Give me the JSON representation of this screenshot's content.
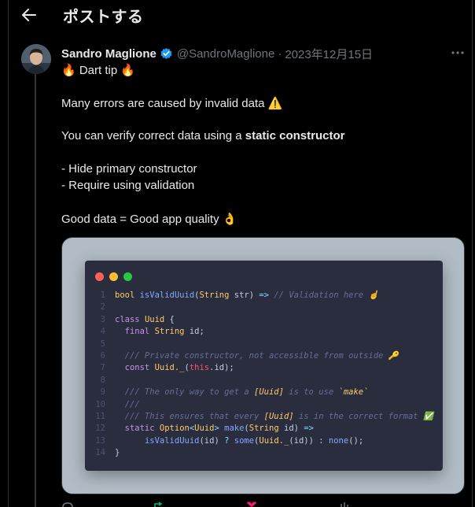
{
  "header": {
    "title": "ポストする"
  },
  "post": {
    "author_name": "Sandro Maglione",
    "handle": "@SandroMaglione",
    "separator": "·",
    "date": "2023年12月15日",
    "lines": {
      "l1": "🔥 Dart tip 🔥",
      "l2": "Many errors are caused by invalid data ⚠️",
      "l3_prefix": "You can verify correct data using a ",
      "l3_bold": "static constructor",
      "l4": "- Hide primary constructor",
      "l5": "- Require using validation",
      "l6": "Good data = Good app quality 👌"
    }
  },
  "code": {
    "line_numbers": [
      "1",
      "2",
      "3",
      "4",
      "5",
      "6",
      "7",
      "8",
      "9",
      "10",
      "11",
      "12",
      "13",
      "14"
    ],
    "l1": {
      "a": "bool ",
      "b": "isValidUuid",
      "c": "(",
      "d": "String",
      "e": " str) ",
      "f": "=>",
      "g": " // Validation here ☝"
    },
    "l3": {
      "a": "class ",
      "b": "Uuid",
      "c": " {"
    },
    "l4": {
      "a": "  final ",
      "b": "String",
      "c": " id;"
    },
    "l6": {
      "a": "  /// Private constructor, not accessible from outside 🔑"
    },
    "l7": {
      "a": "  const ",
      "b": "Uuid._",
      "c": "(",
      "d": "this",
      "e": ".id);"
    },
    "l9": {
      "a": "  /// The only way to get a ",
      "b": "[Uuid]",
      "c": " is to use ",
      "d": "`make`"
    },
    "l10": {
      "a": "  ///"
    },
    "l11": {
      "a": "  /// This ensures that every ",
      "b": "[Uuid]",
      "c": " is in the correct format ✅"
    },
    "l12": {
      "a": "  static ",
      "b": "Option",
      "c": "<",
      "d": "Uuid",
      "e": "> ",
      "f": "make",
      "g": "(",
      "h": "String",
      "i": " id) ",
      "j": "=>"
    },
    "l13": {
      "a": "      ",
      "b": "isValidUuid",
      "c": "(id) ",
      "d": "?",
      "e": " ",
      "f": "some",
      "g": "(",
      "h": "Uuid._",
      "i": "(id)) ",
      "j": ":",
      "k": " ",
      "l": "none",
      "m": "();"
    },
    "l14": {
      "a": "}"
    }
  },
  "colors": {
    "verified_badge": "#1d9bf0",
    "traffic_red": "#ff5f57",
    "traffic_yellow": "#febc2e",
    "traffic_green": "#28c840",
    "card_bg": "#b2bcc6",
    "code_bg": "#292d3e"
  },
  "icons": [
    "back-arrow-icon",
    "verified-badge-icon",
    "more-dots-icon",
    "reply-icon",
    "repost-icon",
    "like-icon",
    "views-icon"
  ]
}
